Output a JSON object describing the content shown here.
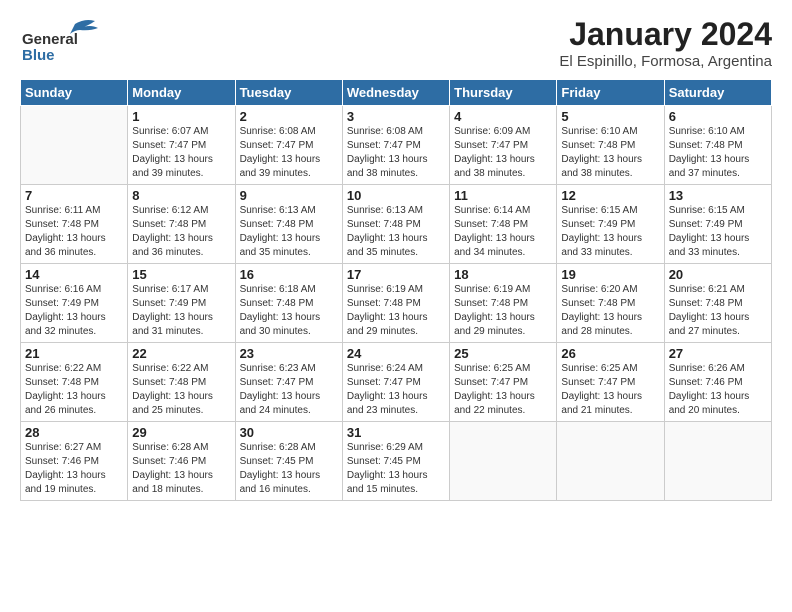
{
  "header": {
    "logo_general": "General",
    "logo_blue": "Blue",
    "title": "January 2024",
    "subtitle": "El Espinillo, Formosa, Argentina"
  },
  "days_of_week": [
    "Sunday",
    "Monday",
    "Tuesday",
    "Wednesday",
    "Thursday",
    "Friday",
    "Saturday"
  ],
  "weeks": [
    [
      {
        "day": "",
        "info": ""
      },
      {
        "day": "1",
        "info": "Sunrise: 6:07 AM\nSunset: 7:47 PM\nDaylight: 13 hours\nand 39 minutes."
      },
      {
        "day": "2",
        "info": "Sunrise: 6:08 AM\nSunset: 7:47 PM\nDaylight: 13 hours\nand 39 minutes."
      },
      {
        "day": "3",
        "info": "Sunrise: 6:08 AM\nSunset: 7:47 PM\nDaylight: 13 hours\nand 38 minutes."
      },
      {
        "day": "4",
        "info": "Sunrise: 6:09 AM\nSunset: 7:47 PM\nDaylight: 13 hours\nand 38 minutes."
      },
      {
        "day": "5",
        "info": "Sunrise: 6:10 AM\nSunset: 7:48 PM\nDaylight: 13 hours\nand 38 minutes."
      },
      {
        "day": "6",
        "info": "Sunrise: 6:10 AM\nSunset: 7:48 PM\nDaylight: 13 hours\nand 37 minutes."
      }
    ],
    [
      {
        "day": "7",
        "info": "Sunrise: 6:11 AM\nSunset: 7:48 PM\nDaylight: 13 hours\nand 36 minutes."
      },
      {
        "day": "8",
        "info": "Sunrise: 6:12 AM\nSunset: 7:48 PM\nDaylight: 13 hours\nand 36 minutes."
      },
      {
        "day": "9",
        "info": "Sunrise: 6:13 AM\nSunset: 7:48 PM\nDaylight: 13 hours\nand 35 minutes."
      },
      {
        "day": "10",
        "info": "Sunrise: 6:13 AM\nSunset: 7:48 PM\nDaylight: 13 hours\nand 35 minutes."
      },
      {
        "day": "11",
        "info": "Sunrise: 6:14 AM\nSunset: 7:48 PM\nDaylight: 13 hours\nand 34 minutes."
      },
      {
        "day": "12",
        "info": "Sunrise: 6:15 AM\nSunset: 7:49 PM\nDaylight: 13 hours\nand 33 minutes."
      },
      {
        "day": "13",
        "info": "Sunrise: 6:15 AM\nSunset: 7:49 PM\nDaylight: 13 hours\nand 33 minutes."
      }
    ],
    [
      {
        "day": "14",
        "info": "Sunrise: 6:16 AM\nSunset: 7:49 PM\nDaylight: 13 hours\nand 32 minutes."
      },
      {
        "day": "15",
        "info": "Sunrise: 6:17 AM\nSunset: 7:49 PM\nDaylight: 13 hours\nand 31 minutes."
      },
      {
        "day": "16",
        "info": "Sunrise: 6:18 AM\nSunset: 7:48 PM\nDaylight: 13 hours\nand 30 minutes."
      },
      {
        "day": "17",
        "info": "Sunrise: 6:19 AM\nSunset: 7:48 PM\nDaylight: 13 hours\nand 29 minutes."
      },
      {
        "day": "18",
        "info": "Sunrise: 6:19 AM\nSunset: 7:48 PM\nDaylight: 13 hours\nand 29 minutes."
      },
      {
        "day": "19",
        "info": "Sunrise: 6:20 AM\nSunset: 7:48 PM\nDaylight: 13 hours\nand 28 minutes."
      },
      {
        "day": "20",
        "info": "Sunrise: 6:21 AM\nSunset: 7:48 PM\nDaylight: 13 hours\nand 27 minutes."
      }
    ],
    [
      {
        "day": "21",
        "info": "Sunrise: 6:22 AM\nSunset: 7:48 PM\nDaylight: 13 hours\nand 26 minutes."
      },
      {
        "day": "22",
        "info": "Sunrise: 6:22 AM\nSunset: 7:48 PM\nDaylight: 13 hours\nand 25 minutes."
      },
      {
        "day": "23",
        "info": "Sunrise: 6:23 AM\nSunset: 7:47 PM\nDaylight: 13 hours\nand 24 minutes."
      },
      {
        "day": "24",
        "info": "Sunrise: 6:24 AM\nSunset: 7:47 PM\nDaylight: 13 hours\nand 23 minutes."
      },
      {
        "day": "25",
        "info": "Sunrise: 6:25 AM\nSunset: 7:47 PM\nDaylight: 13 hours\nand 22 minutes."
      },
      {
        "day": "26",
        "info": "Sunrise: 6:25 AM\nSunset: 7:47 PM\nDaylight: 13 hours\nand 21 minutes."
      },
      {
        "day": "27",
        "info": "Sunrise: 6:26 AM\nSunset: 7:46 PM\nDaylight: 13 hours\nand 20 minutes."
      }
    ],
    [
      {
        "day": "28",
        "info": "Sunrise: 6:27 AM\nSunset: 7:46 PM\nDaylight: 13 hours\nand 19 minutes."
      },
      {
        "day": "29",
        "info": "Sunrise: 6:28 AM\nSunset: 7:46 PM\nDaylight: 13 hours\nand 18 minutes."
      },
      {
        "day": "30",
        "info": "Sunrise: 6:28 AM\nSunset: 7:45 PM\nDaylight: 13 hours\nand 16 minutes."
      },
      {
        "day": "31",
        "info": "Sunrise: 6:29 AM\nSunset: 7:45 PM\nDaylight: 13 hours\nand 15 minutes."
      },
      {
        "day": "",
        "info": ""
      },
      {
        "day": "",
        "info": ""
      },
      {
        "day": "",
        "info": ""
      }
    ]
  ]
}
